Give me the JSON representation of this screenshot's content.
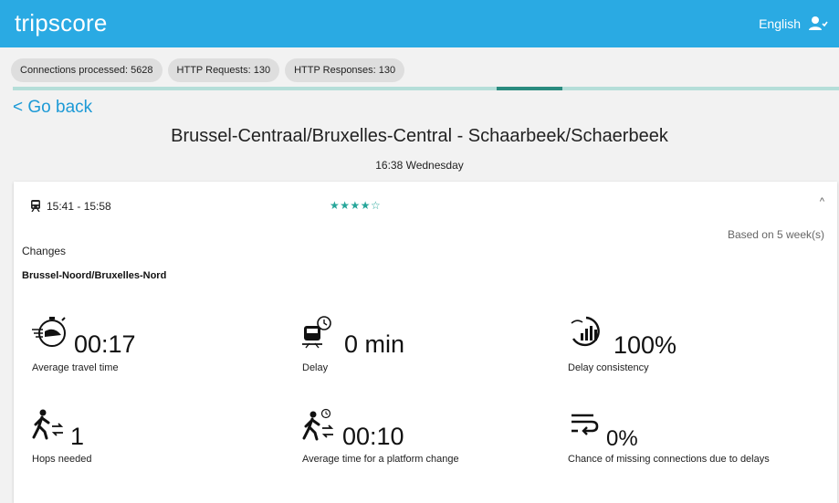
{
  "app": {
    "brand": "tripscore",
    "language": "English"
  },
  "stats": [
    {
      "label": "Connections processed: 5628"
    },
    {
      "label": "HTTP Requests: 130"
    },
    {
      "label": "HTTP Responses: 130"
    }
  ],
  "progress": {
    "value_percent": 8
  },
  "nav": {
    "back_label": "< Go back"
  },
  "route": {
    "title": "Brussel-Centraal/Bruxelles-Central - Schaarbeek/Schaerbeek",
    "departure": "16:38 Wednesday"
  },
  "trip": {
    "time_range": "15:41 - 15:58",
    "rating": 4.5,
    "stars_text": "★★★★☆",
    "based_on": "Based on 5 week(s)",
    "changes_label": "Changes",
    "change_station": "Brussel-Noord/Bruxelles-Nord"
  },
  "metrics": {
    "travel_time": {
      "value": "00:17",
      "label": "Average travel time",
      "icon": "stopwatch-train-icon"
    },
    "delay": {
      "value": "0 min",
      "label": "Delay",
      "icon": "train-delay-icon"
    },
    "consistency": {
      "value": "100%",
      "label": "Delay consistency",
      "icon": "consistency-gauge-icon"
    },
    "hops": {
      "value": "1",
      "label": "Hops needed",
      "icon": "walking-transfer-icon"
    },
    "platform_change": {
      "value": "00:10",
      "label": "Average time for a platform change",
      "icon": "walking-transfer-timer-icon"
    },
    "missed": {
      "value": "0%",
      "label": "Chance of missing connections due to delays",
      "icon": "missed-connection-icon"
    }
  },
  "colors": {
    "appbar": "#2aaae3",
    "accent_link": "#1d9ad6",
    "stars": "#26a69a",
    "progress": "#2a8b7f"
  }
}
